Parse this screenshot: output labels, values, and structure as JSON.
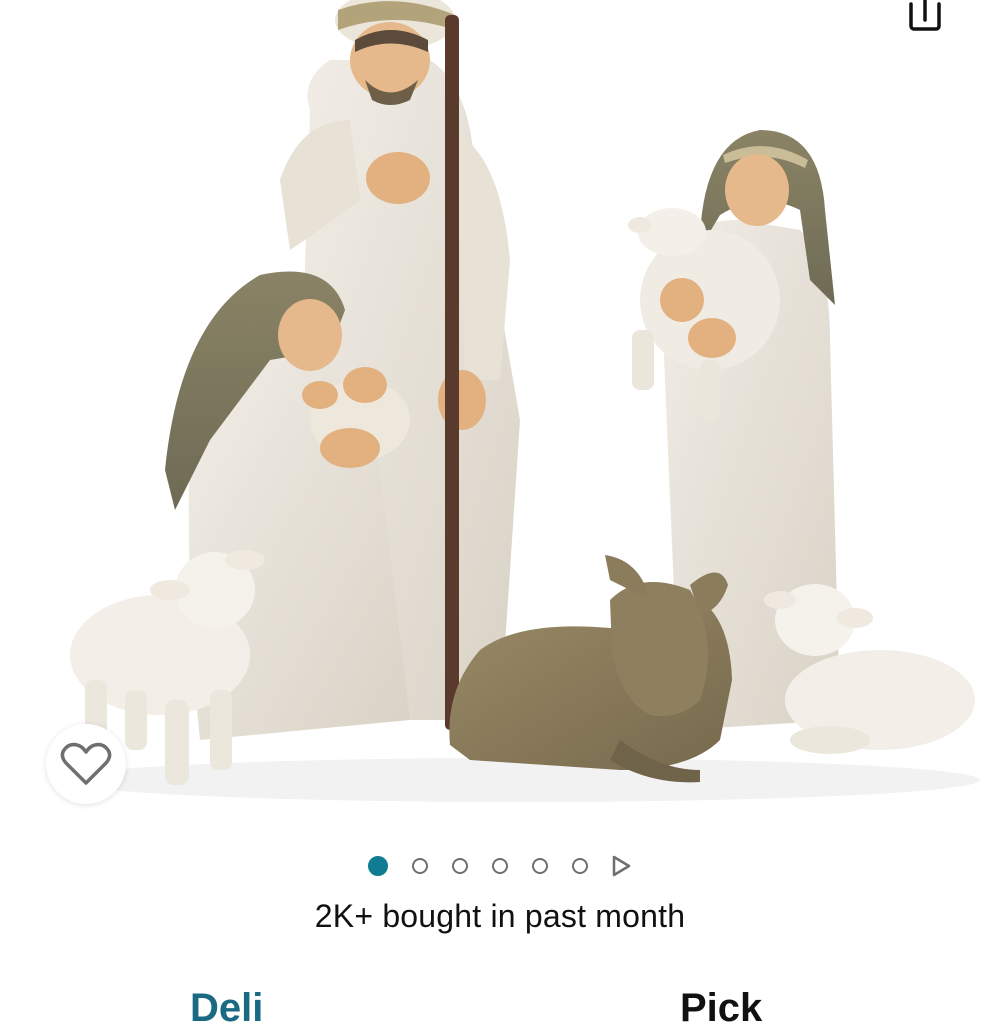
{
  "header": {
    "share_icon": "share-icon"
  },
  "product": {
    "image_alt": "Nativity figurine set",
    "wishlist_icon": "heart-outline-icon"
  },
  "carousel": {
    "total_pages": 6,
    "active_page": 1,
    "next_icon": "play-arrow-icon",
    "active_color": "#0f7c91"
  },
  "social_proof": {
    "bought_text": "2K+ bought in past month"
  },
  "below_fold": {
    "left_partial": "Deli",
    "right_partial": "Pick"
  }
}
